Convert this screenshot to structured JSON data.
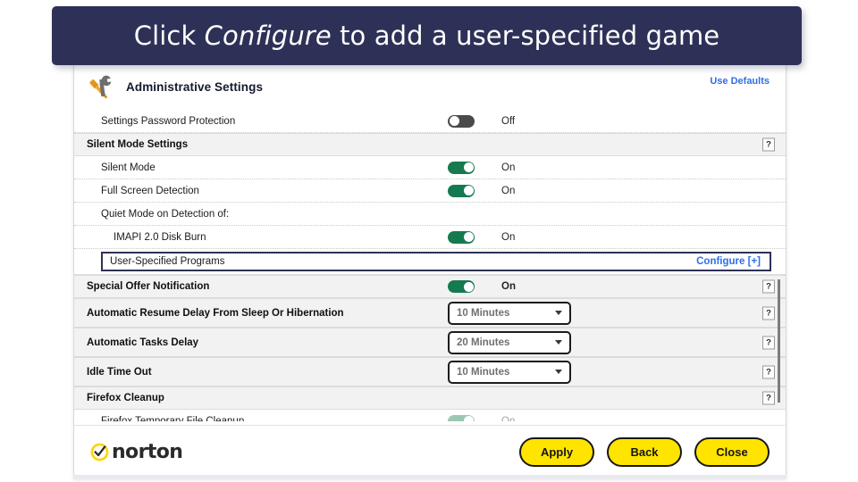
{
  "banner": {
    "prefix": "Click ",
    "emphasis": "Configure",
    "suffix": " to add a user-specified game",
    "background_color": "#2e3157",
    "text_color": "#ffffff"
  },
  "window": {
    "title": "Administrative Settings",
    "title_icon": "wrench-screwdriver-icon",
    "use_defaults_link": "Use Defaults",
    "accent_link_color": "#2f6fe4"
  },
  "settings_rows": [
    {
      "label": "Settings Password Protection",
      "type": "toggle",
      "toggle_state": "off",
      "state_text": "Off",
      "indent": 1,
      "help": false
    },
    {
      "label": "Silent Mode Settings",
      "type": "section",
      "indent": 0,
      "help": true,
      "help_label": "?"
    },
    {
      "label": "Silent Mode",
      "type": "toggle",
      "toggle_state": "on",
      "state_text": "On",
      "indent": 1,
      "help": false
    },
    {
      "label": "Full Screen Detection",
      "type": "toggle",
      "toggle_state": "on",
      "state_text": "On",
      "indent": 1,
      "help": false
    },
    {
      "label": "Quiet Mode on Detection of:",
      "type": "plain",
      "indent": 1,
      "help": false
    },
    {
      "label": "IMAPI 2.0 Disk Burn",
      "type": "toggle",
      "toggle_state": "on",
      "state_text": "On",
      "indent": 2,
      "help": false
    },
    {
      "label": "User-Specified Programs",
      "type": "highlight",
      "link_text": "Configure [+]",
      "indent": 2,
      "help": false
    },
    {
      "label": "Special Offer Notification",
      "type": "section-toggle",
      "toggle_state": "on",
      "state_text": "On",
      "indent": 0,
      "help": true,
      "help_label": "?"
    },
    {
      "label": "Automatic Resume Delay From Sleep Or Hibernation",
      "type": "section-dropdown",
      "dropdown_value": "10 Minutes",
      "indent": 0,
      "help": true,
      "help_label": "?"
    },
    {
      "label": "Automatic Tasks Delay",
      "type": "section-dropdown",
      "dropdown_value": "20 Minutes",
      "indent": 0,
      "help": true,
      "help_label": "?"
    },
    {
      "label": "Idle Time Out",
      "type": "section-dropdown",
      "dropdown_value": "10 Minutes",
      "indent": 0,
      "help": true,
      "help_label": "?"
    },
    {
      "label": "Firefox Cleanup",
      "type": "section",
      "indent": 0,
      "help": true,
      "help_label": "?"
    },
    {
      "label": "Firefox Temporary File Cleanup",
      "type": "toggle",
      "toggle_state": "on",
      "state_text": "On",
      "indent": 1,
      "help": false,
      "dimmed": true
    }
  ],
  "footer": {
    "logo_text": "norton",
    "logo_mark": "check-circle-icon",
    "logo_color": "#ffd400",
    "buttons": [
      {
        "label": "Apply"
      },
      {
        "label": "Back"
      },
      {
        "label": "Close"
      }
    ],
    "button_color": "#ffe400"
  },
  "scrollbar": {
    "orientation": "vertical",
    "thumb_color": "#7d7d7d"
  }
}
